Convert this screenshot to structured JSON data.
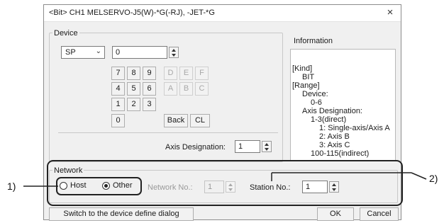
{
  "window": {
    "title": "<Bit> CH1 MELSERVO-J5(W)-*G(-RJ), -JET-*G",
    "close_glyph": "×"
  },
  "device": {
    "group_label": "Device",
    "type_value": "SP",
    "number_value": "0",
    "keypad": {
      "digits": [
        "7",
        "8",
        "9",
        "4",
        "5",
        "6",
        "1",
        "2",
        "3",
        "0"
      ],
      "hex": [
        "D",
        "E",
        "F",
        "A",
        "B",
        "C"
      ],
      "back_label": "Back",
      "clear_label": "CL"
    },
    "axis_designation_label": "Axis Designation:",
    "axis_designation_value": "1"
  },
  "information": {
    "label": "Information",
    "lines": [
      "[Kind]",
      "BIT",
      "[Range]",
      "Device:",
      "0-6",
      "Axis Designation:",
      "1-3(direct)",
      "1: Single-axis/Axis A",
      "2: Axis B",
      "3: Axis C",
      "100-115(indirect)"
    ]
  },
  "network": {
    "group_label": "Network",
    "host_label": "Host",
    "other_label": "Other",
    "selected": "Other",
    "network_no_label": "Network No.:",
    "network_no_value": "1",
    "station_no_label": "Station No.:",
    "station_no_value": "1"
  },
  "footer": {
    "switch_label": "Switch to the device define dialog",
    "ok_label": "OK",
    "cancel_label": "Cancel"
  },
  "annotations": {
    "callout_1": "1)",
    "callout_2": "2)"
  }
}
